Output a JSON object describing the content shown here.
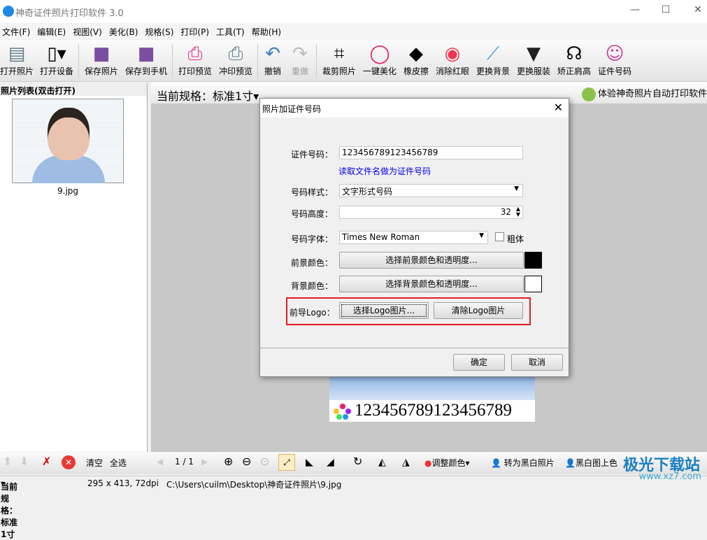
{
  "window": {
    "title": "神奇证件照片打印软件 3.0"
  },
  "menu": [
    "文件(F)",
    "编辑(E)",
    "视图(V)",
    "美化(B)",
    "规格(S)",
    "打印(P)",
    "工具(T)",
    "帮助(H)"
  ],
  "toolbar": [
    {
      "label": "打开照片",
      "icon": "open-photo-icon"
    },
    {
      "label": "打开设备",
      "icon": "phone-icon"
    },
    {
      "label": "保存照片",
      "icon": "save-icon"
    },
    {
      "label": "保存到手机",
      "icon": "save-to-phone-icon"
    },
    {
      "label": "打印预览",
      "icon": "printer-icon"
    },
    {
      "label": "冲印预览",
      "icon": "print-zoom-icon"
    },
    {
      "label": "撤销",
      "icon": "undo-icon"
    },
    {
      "label": "重做",
      "icon": "redo-icon"
    },
    {
      "label": "裁剪照片",
      "icon": "crop-icon"
    },
    {
      "label": "一键美化",
      "icon": "color-ring-icon"
    },
    {
      "label": "橡皮擦",
      "icon": "eraser-icon"
    },
    {
      "label": "消除红眼",
      "icon": "eye-icon"
    },
    {
      "label": "更换背景",
      "icon": "brush-icon"
    },
    {
      "label": "更换服装",
      "icon": "suit-icon"
    },
    {
      "label": "矫正肩高",
      "icon": "shoulder-icon"
    },
    {
      "label": "证件号码",
      "icon": "id-photo-icon"
    }
  ],
  "left_panel": {
    "title": "照片列表(双击打开)",
    "items": [
      {
        "filename": "9.jpg"
      }
    ],
    "clear": "清空",
    "select_all": "全选"
  },
  "main": {
    "spec": "当前规格：标准1寸",
    "promo": "体验神奇照片自动打印软件",
    "photo_number": "123456789123456789"
  },
  "dialog": {
    "title": "照片加证件号码",
    "id_label": "证件号码：",
    "id_value": "123456789123456789",
    "read_filename_link": "读取文件名做为证件号码",
    "style_label": "号码样式：",
    "style_value": "文字形式号码",
    "height_label": "号码高度：",
    "height_value": "32",
    "font_label": "号码字体：",
    "font_value": "Times New Roman",
    "bold_label": "粗体",
    "bold_checked": false,
    "fg_label": "前景颜色：",
    "fg_button": "选择前景颜色和透明度...",
    "fg_color": "#000000",
    "bg_label": "背景颜色：",
    "bg_button": "选择背景颜色和透明度...",
    "bg_color": "#ffffff",
    "logo_label": "前导Logo：",
    "logo_select": "选择Logo图片...",
    "logo_clear": "清除Logo图片",
    "ok": "确定",
    "cancel": "取消"
  },
  "bottom_toolbar": {
    "page": "1 / 1",
    "adjust_color": "调整颜色",
    "to_bw": "转为黑白照片",
    "colorize": "黑白图上色"
  },
  "status": {
    "spec": "当前规格：标准1寸",
    "size": "295 x 413, 72dpi",
    "path": "C:\\Users\\cuilm\\Desktop\\神奇证件照片\\9.jpg"
  },
  "watermark": {
    "name": "极光下载站",
    "url": "www.xz7.com"
  }
}
